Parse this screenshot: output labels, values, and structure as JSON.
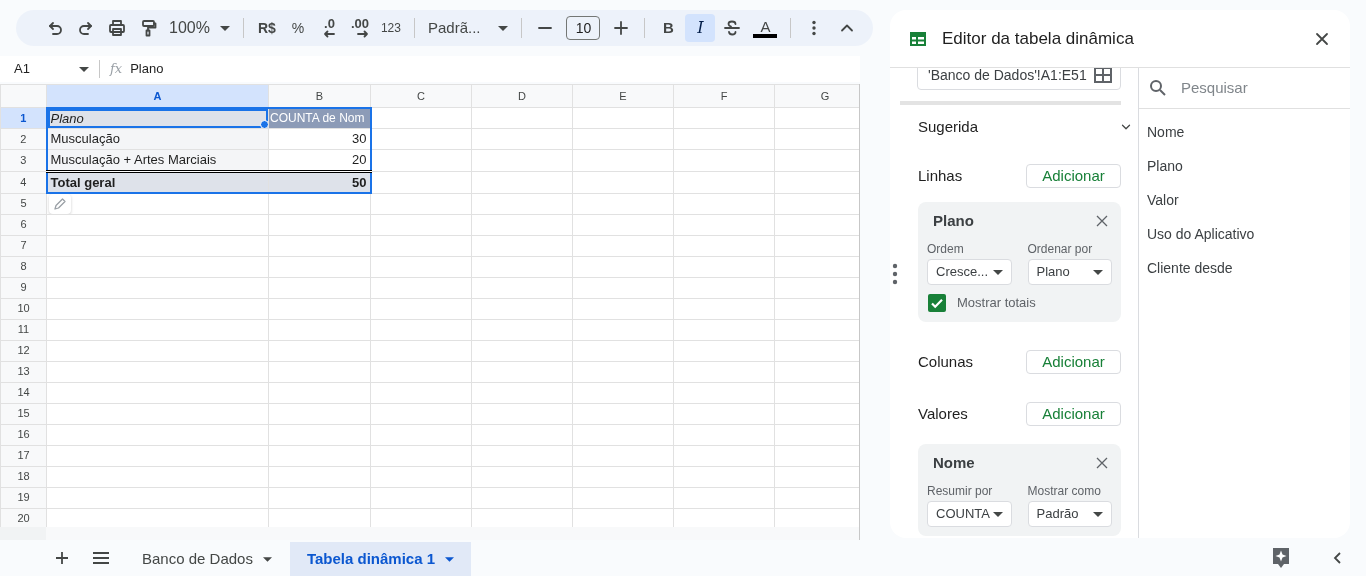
{
  "toolbar": {
    "items": [
      {
        "kind": "undo"
      },
      {
        "kind": "redo"
      },
      {
        "kind": "print"
      },
      {
        "kind": "paint"
      },
      {
        "kind": "zoom",
        "label": "100%"
      },
      {
        "kind": "sep"
      },
      {
        "kind": "currency",
        "label": "R$"
      },
      {
        "kind": "percent",
        "label": "%"
      },
      {
        "kind": "decdown",
        "label": ".0"
      },
      {
        "kind": "decup",
        "label": ".00"
      },
      {
        "kind": "numfmt",
        "label": "123"
      },
      {
        "kind": "sep"
      },
      {
        "kind": "font",
        "label": "Padrã..."
      },
      {
        "kind": "sep"
      },
      {
        "kind": "minus"
      },
      {
        "kind": "size",
        "label": "10"
      },
      {
        "kind": "plus"
      },
      {
        "kind": "sep"
      },
      {
        "kind": "bold",
        "label": "B",
        "on": false
      },
      {
        "kind": "italic",
        "label": "I",
        "on": true
      },
      {
        "kind": "strike",
        "on": false
      },
      {
        "kind": "color",
        "label": "A"
      },
      {
        "kind": "sep"
      },
      {
        "kind": "more"
      },
      {
        "kind": "collapse"
      }
    ]
  },
  "formula_bar": {
    "cell_ref": "A1",
    "function_symbol": "fx",
    "formula": "Plano"
  },
  "grid": {
    "columns": [
      {
        "label": "A",
        "selected": true
      },
      {
        "label": "B",
        "selected": false
      },
      {
        "label": "C",
        "selected": false
      },
      {
        "label": "D",
        "selected": false
      },
      {
        "label": "E",
        "selected": false
      },
      {
        "label": "F",
        "selected": false
      },
      {
        "label": "G",
        "selected": false
      }
    ],
    "rows": [
      {
        "number": "1",
        "selected": true,
        "kind": "header",
        "cells": [
          "Plano",
          "COUNTA de Nom"
        ]
      },
      {
        "number": "2",
        "selected": false,
        "kind": "item",
        "cells": [
          "Musculação",
          "30"
        ]
      },
      {
        "number": "3",
        "selected": false,
        "kind": "item",
        "cells": [
          "Musculação + Artes Marciais",
          "20"
        ]
      },
      {
        "number": "4",
        "selected": false,
        "kind": "total",
        "cells": [
          "Total geral",
          "50"
        ]
      },
      {
        "number": "5",
        "selected": false
      },
      {
        "number": "6",
        "selected": false
      },
      {
        "number": "7",
        "selected": false
      },
      {
        "number": "8",
        "selected": false
      },
      {
        "number": "9",
        "selected": false
      },
      {
        "number": "10",
        "selected": false
      },
      {
        "number": "11",
        "selected": false
      },
      {
        "number": "12",
        "selected": false
      },
      {
        "number": "13",
        "selected": false
      },
      {
        "number": "14",
        "selected": false
      },
      {
        "number": "15",
        "selected": false
      },
      {
        "number": "16",
        "selected": false
      },
      {
        "number": "17",
        "selected": false
      },
      {
        "number": "18",
        "selected": false
      },
      {
        "number": "19",
        "selected": false
      },
      {
        "number": "20",
        "selected": false
      }
    ]
  },
  "pivot_editor": {
    "title": "Editor da tabela dinâmica",
    "range": "'Banco de Dados'!A1:E51",
    "suggested": {
      "label": "Sugerida",
      "expanded": false
    },
    "sections": [
      {
        "label": "Linhas",
        "button": "Adicionar",
        "cards": [
          {
            "title": "Plano",
            "fields": [
              {
                "label": "Ordem",
                "value": "Cresce..."
              },
              {
                "label": "Ordenar por",
                "value": "Plano"
              }
            ],
            "checkbox": {
              "label": "Mostrar totais",
              "checked": true
            }
          }
        ]
      },
      {
        "label": "Colunas",
        "button": "Adicionar"
      },
      {
        "label": "Valores",
        "button": "Adicionar",
        "cards": [
          {
            "title": "Nome",
            "fields": [
              {
                "label": "Resumir por",
                "value": "COUNTA"
              },
              {
                "label": "Mostrar como",
                "value": "Padrão"
              }
            ]
          }
        ]
      }
    ],
    "search": {
      "placeholder": "Pesquisar"
    },
    "field_list": [
      "Nome",
      "Plano",
      "Valor",
      "Uso do Aplicativo",
      "Cliente desde"
    ]
  },
  "sheet_tabs": [
    {
      "label": "Banco de Dados",
      "selected": false
    },
    {
      "label": "Tabela dinâmica 1",
      "selected": true
    }
  ]
}
